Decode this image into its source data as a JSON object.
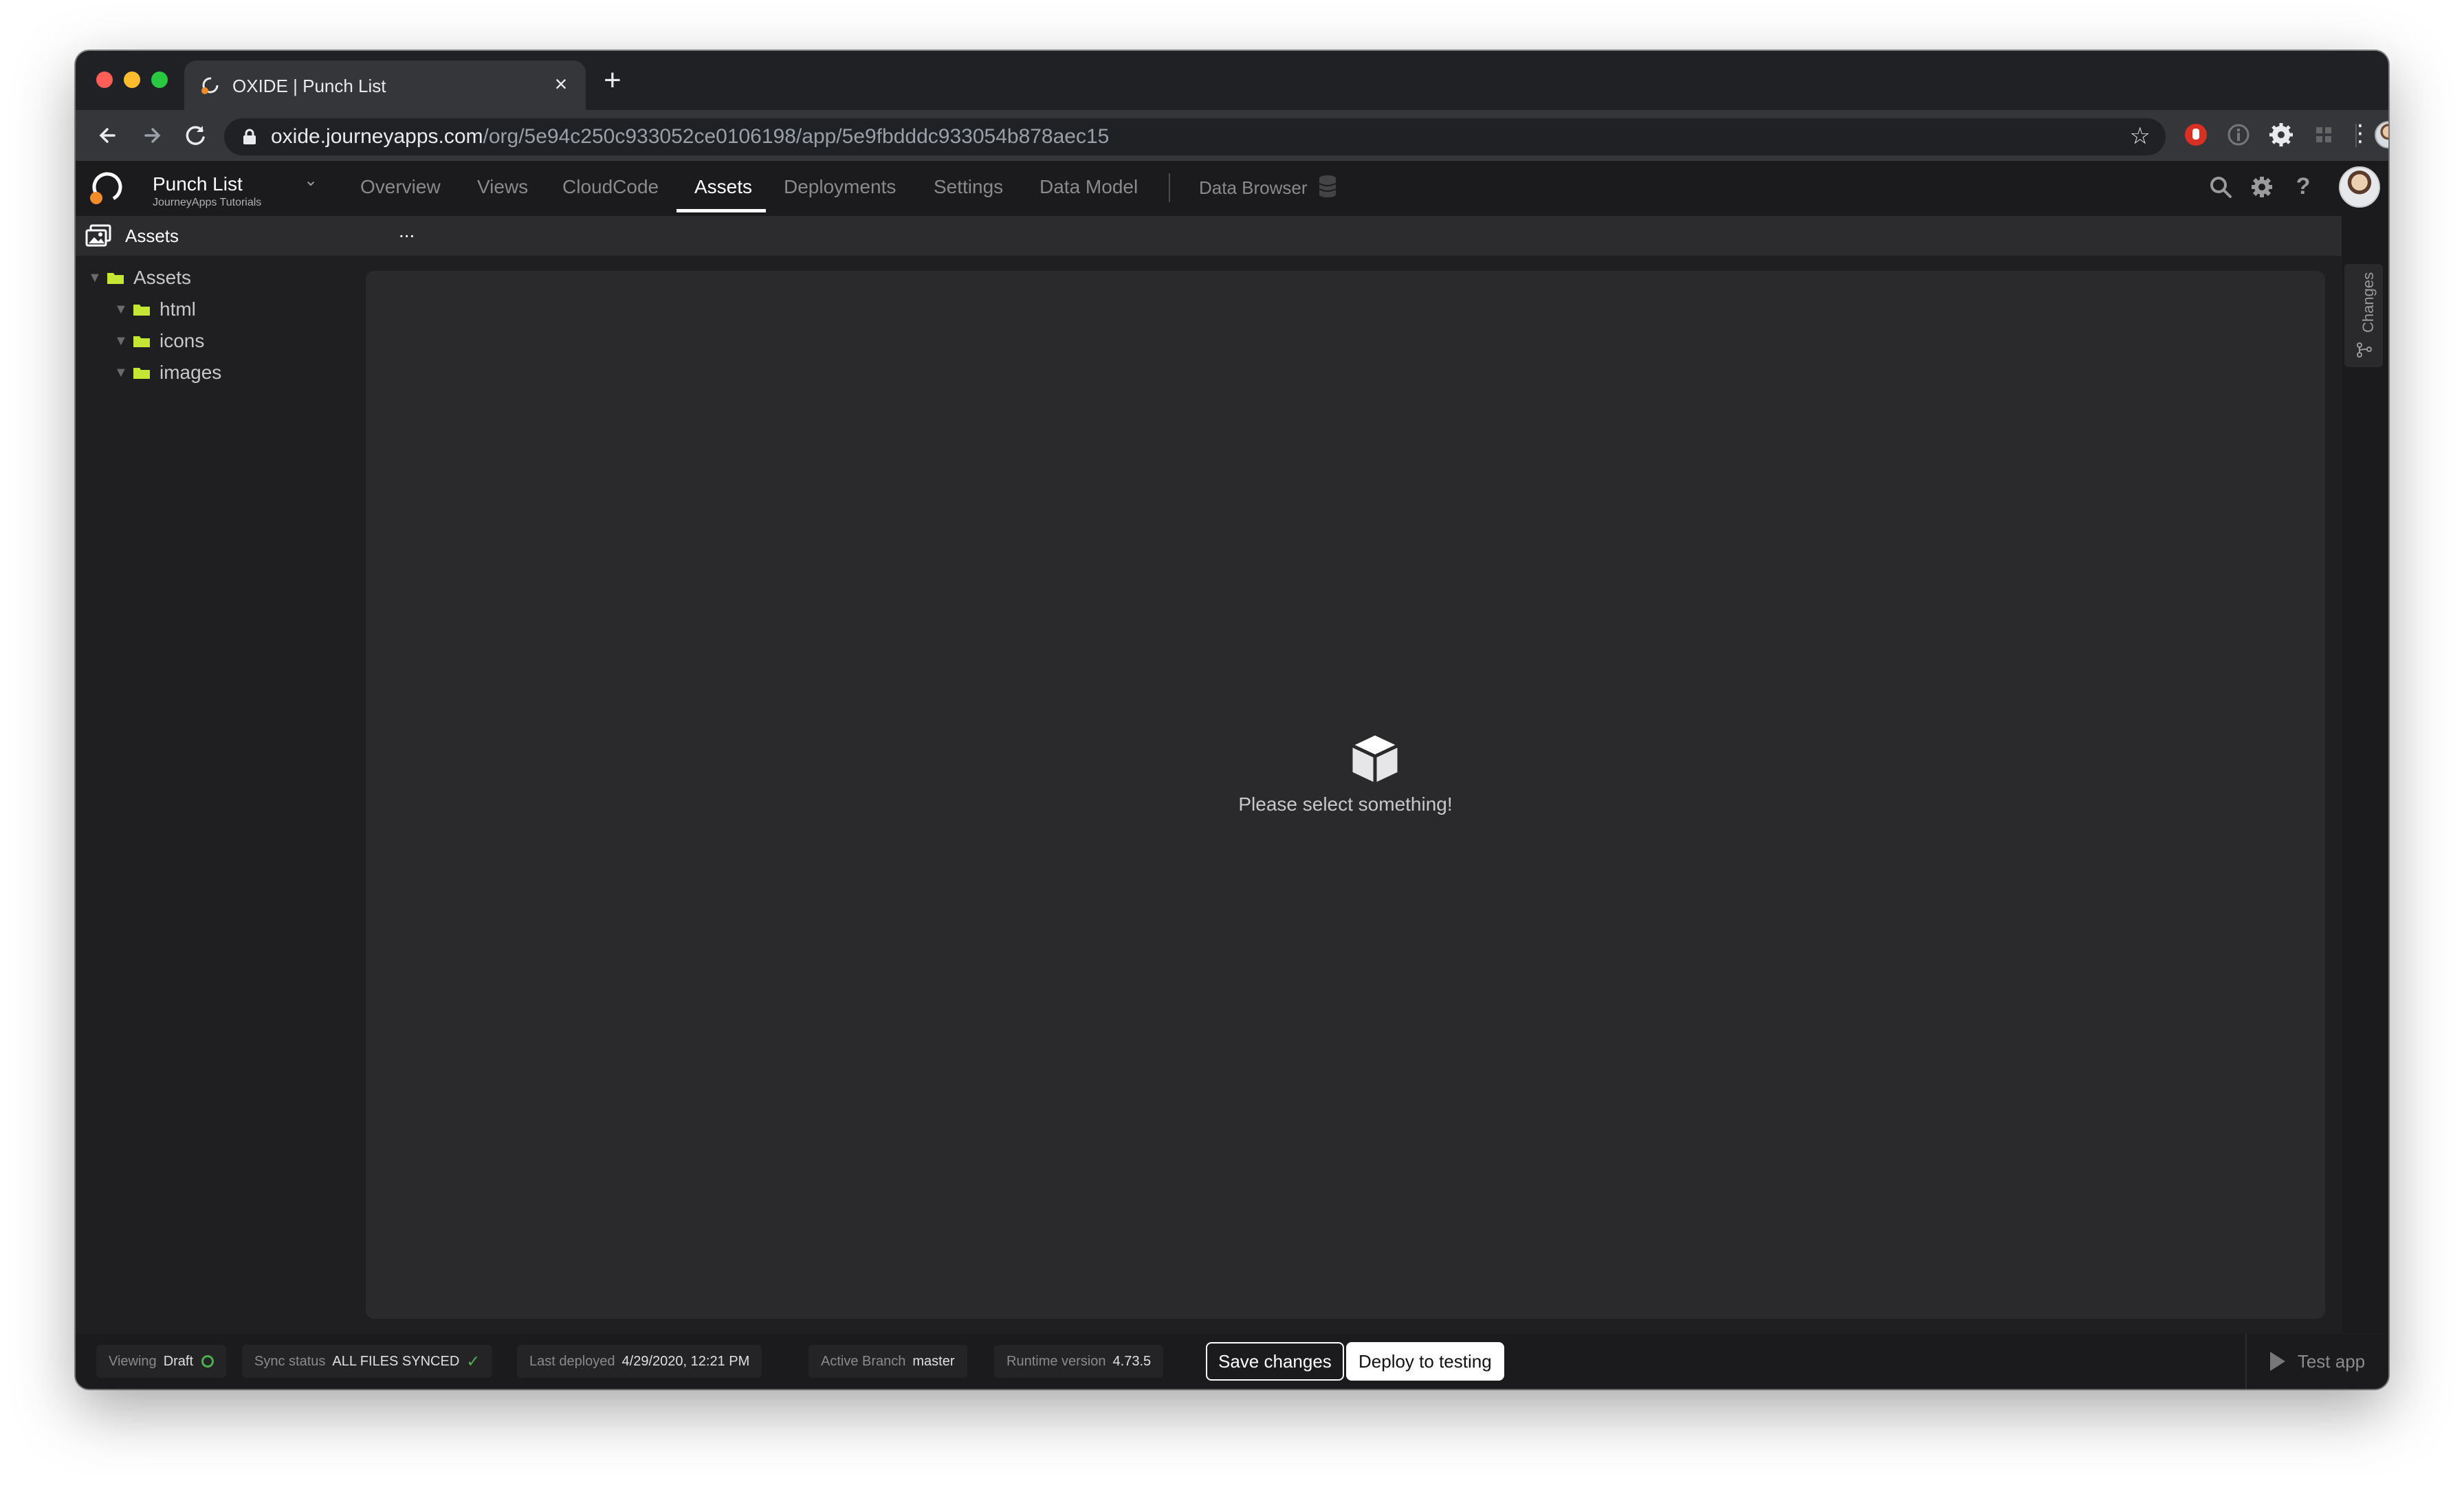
{
  "browser": {
    "tab_title": "OXIDE | Punch List",
    "tab_close": "×",
    "new_tab": "+",
    "url_host": "oxide.journeyapps.com",
    "url_path": "/org/5e94c250c933052ce0106198/app/5e9fbdddc933054b878aec15"
  },
  "app_header": {
    "project_name": "Punch List",
    "org_name": "JourneyApps Tutorials",
    "nav": [
      "Overview",
      "Views",
      "CloudCode",
      "Assets",
      "Deployments",
      "Settings",
      "Data Model",
      "Data Browser"
    ],
    "active_nav": "Assets"
  },
  "sub_header": {
    "title": "Assets",
    "more": "..."
  },
  "tree": {
    "root": "Assets",
    "children": [
      "html",
      "icons",
      "images"
    ],
    "folder_color": "#c6e636"
  },
  "main": {
    "empty_message": "Please select something!"
  },
  "right_rail": {
    "changes_label": "Changes"
  },
  "footer": {
    "viewing_key": "Viewing",
    "viewing_value": "Draft",
    "sync_key": "Sync status",
    "sync_value": "ALL FILES SYNCED",
    "deployed_key": "Last deployed",
    "deployed_value": "4/29/2020, 12:21 PM",
    "branch_key": "Active Branch",
    "branch_value": "master",
    "runtime_key": "Runtime version",
    "runtime_value": "4.73.5",
    "save_label": "Save changes",
    "deploy_label": "Deploy to testing",
    "test_label": "Test app"
  },
  "icons": {
    "nav_back": "arrow-left-icon",
    "nav_forward": "arrow-right-icon",
    "reload": "reload-icon",
    "lock": "lock-icon",
    "star": "star-icon",
    "search": "search-icon",
    "settings": "gear-icon",
    "help": "help-icon",
    "empty_state": "cube-icon"
  },
  "colors": {
    "accent_orange": "#f08c2a",
    "folder_green": "#c6e636",
    "sync_check": "#4caf50"
  }
}
